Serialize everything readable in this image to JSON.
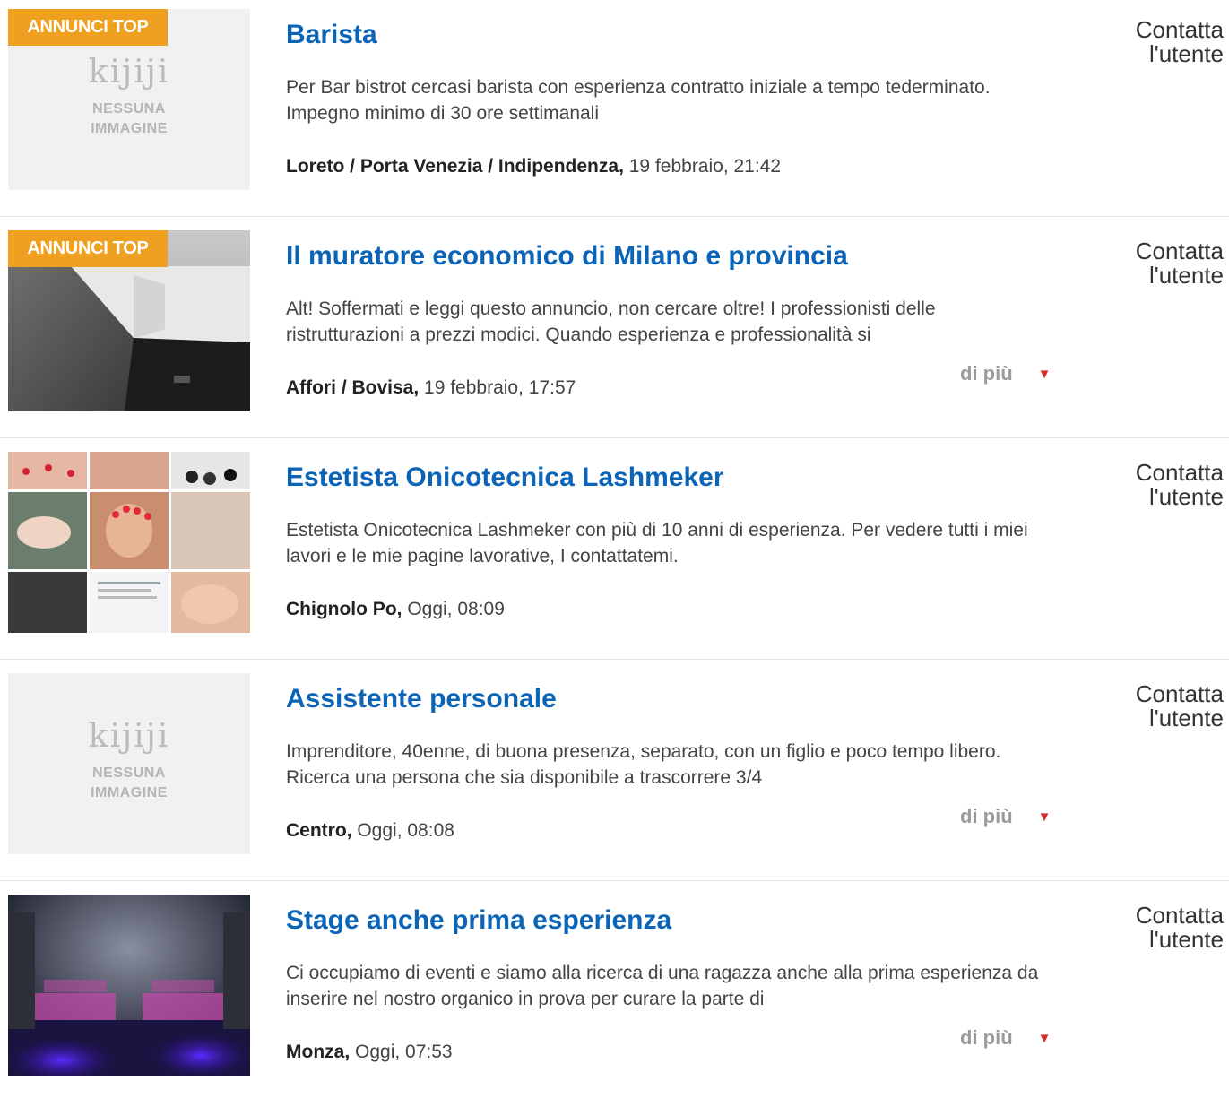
{
  "listings": [
    {
      "top_badge": "ANNUNCI TOP",
      "no_image": {
        "logo": "kijiji",
        "line1": "NESSUNA",
        "line2": "IMMAGINE"
      },
      "title": "Barista",
      "description": "Per Bar bistrot cercasi barista con esperienza contratto iniziale a tempo tederminato. Impegno minimo di 30 ore settimanali",
      "location": "Loreto / Porta Venezia / Indipendenza",
      "date": "19 febbraio, 21:42",
      "contact_line1": "Contatta",
      "contact_line2": "l'utente"
    },
    {
      "top_badge": "ANNUNCI TOP",
      "title": "Il muratore economico di Milano e provincia",
      "description": "Alt! Soffermati e leggi questo annuncio, non cercare oltre! I professionisti delle ristrutturazioni a prezzi modici. Quando esperienza e professionalità si",
      "location": "Affori / Bovisa",
      "date": "19 febbraio, 17:57",
      "more": "di più",
      "contact_line1": "Contatta",
      "contact_line2": "l'utente"
    },
    {
      "title": "Estetista Onicotecnica Lashmeker",
      "description": "Estetista Onicotecnica Lashmeker con più di 10 anni di esperienza. Per vedere tutti i miei lavori e le mie pagine lavorative, I contattatemi.",
      "location": "Chignolo Po",
      "date": "Oggi, 08:09",
      "contact_line1": "Contatta",
      "contact_line2": "l'utente"
    },
    {
      "no_image": {
        "logo": "kijiji",
        "line1": "NESSUNA",
        "line2": "IMMAGINE"
      },
      "title": "Assistente personale",
      "description": "Imprenditore, 40enne, di buona presenza, separato, con un figlio e poco tempo libero. Ricerca una persona che sia disponibile a trascorrere 3/4",
      "location": "Centro",
      "date": "Oggi, 08:08",
      "more": "di più",
      "contact_line1": "Contatta",
      "contact_line2": "l'utente"
    },
    {
      "title": "Stage anche prima esperienza",
      "description": "Ci occupiamo di eventi e siamo alla ricerca di una ragazza anche alla prima esperienza da inserire nel nostro organico in prova per curare la parte di",
      "location": "Monza",
      "date": "Oggi, 07:53",
      "more": "di più",
      "contact_line1": "Contatta",
      "contact_line2": "l'utente"
    }
  ],
  "colors": {
    "title": "#0c64b7",
    "badge": "#f0a020",
    "caret": "#d22b2b"
  }
}
